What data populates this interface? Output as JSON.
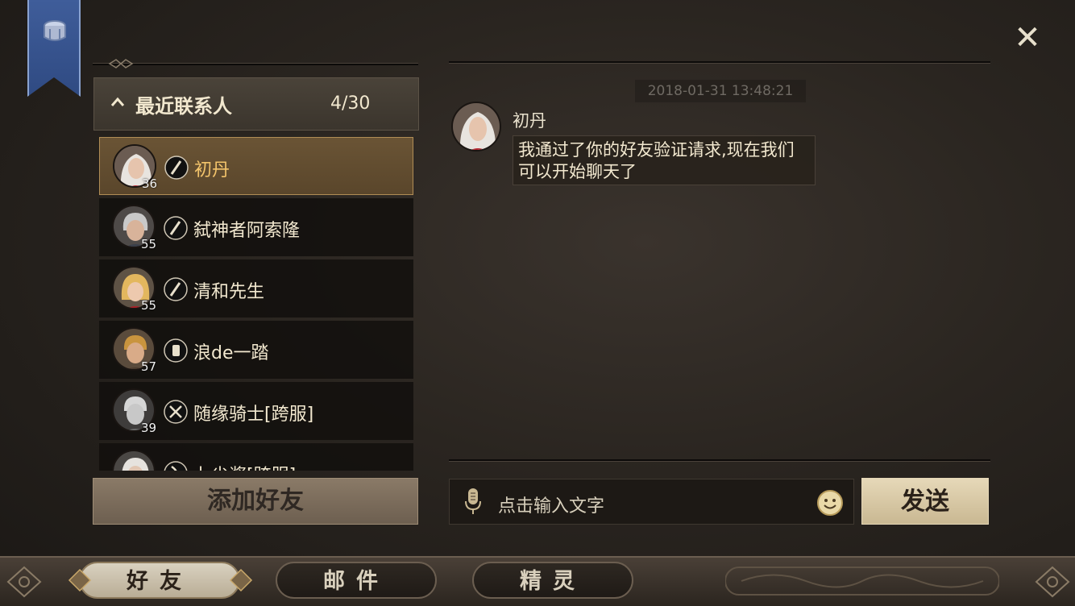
{
  "close_label": "✕",
  "contacts_section": {
    "title": "最近联系人",
    "count": "4/30",
    "contacts": [
      {
        "name": "初丹",
        "level": "36",
        "class_icon": "staff-icon",
        "selected": true
      },
      {
        "name": "弑神者阿索隆",
        "level": "55",
        "class_icon": "staff-icon",
        "selected": false
      },
      {
        "name": "清和先生",
        "level": "55",
        "class_icon": "staff-icon",
        "selected": false
      },
      {
        "name": "浪de一踏",
        "level": "57",
        "class_icon": "gauntlet-icon",
        "selected": false
      },
      {
        "name": "随缘骑士[跨服]",
        "level": "39",
        "class_icon": "crossed-swords-icon",
        "selected": false
      },
      {
        "name": "卜尘酱[跨服]",
        "level": "",
        "class_icon": "bow-icon",
        "selected": false
      }
    ]
  },
  "add_friend_label": "添加好友",
  "chat": {
    "timestamp": "2018-01-31 13:48:21",
    "messages": [
      {
        "sender": "初丹",
        "text": "我通过了你的好友验证请求,现在我们可以开始聊天了"
      }
    ]
  },
  "input": {
    "placeholder": "点击输入文字"
  },
  "send_label": "发送",
  "tabs": [
    {
      "label": "好友",
      "active": true
    },
    {
      "label": "邮件",
      "active": false
    },
    {
      "label": "精灵",
      "active": false
    }
  ],
  "colors": {
    "accent_gold": "#f3c46b",
    "banner_blue": "#3f5d9a",
    "selected_row": "#6a5435"
  }
}
